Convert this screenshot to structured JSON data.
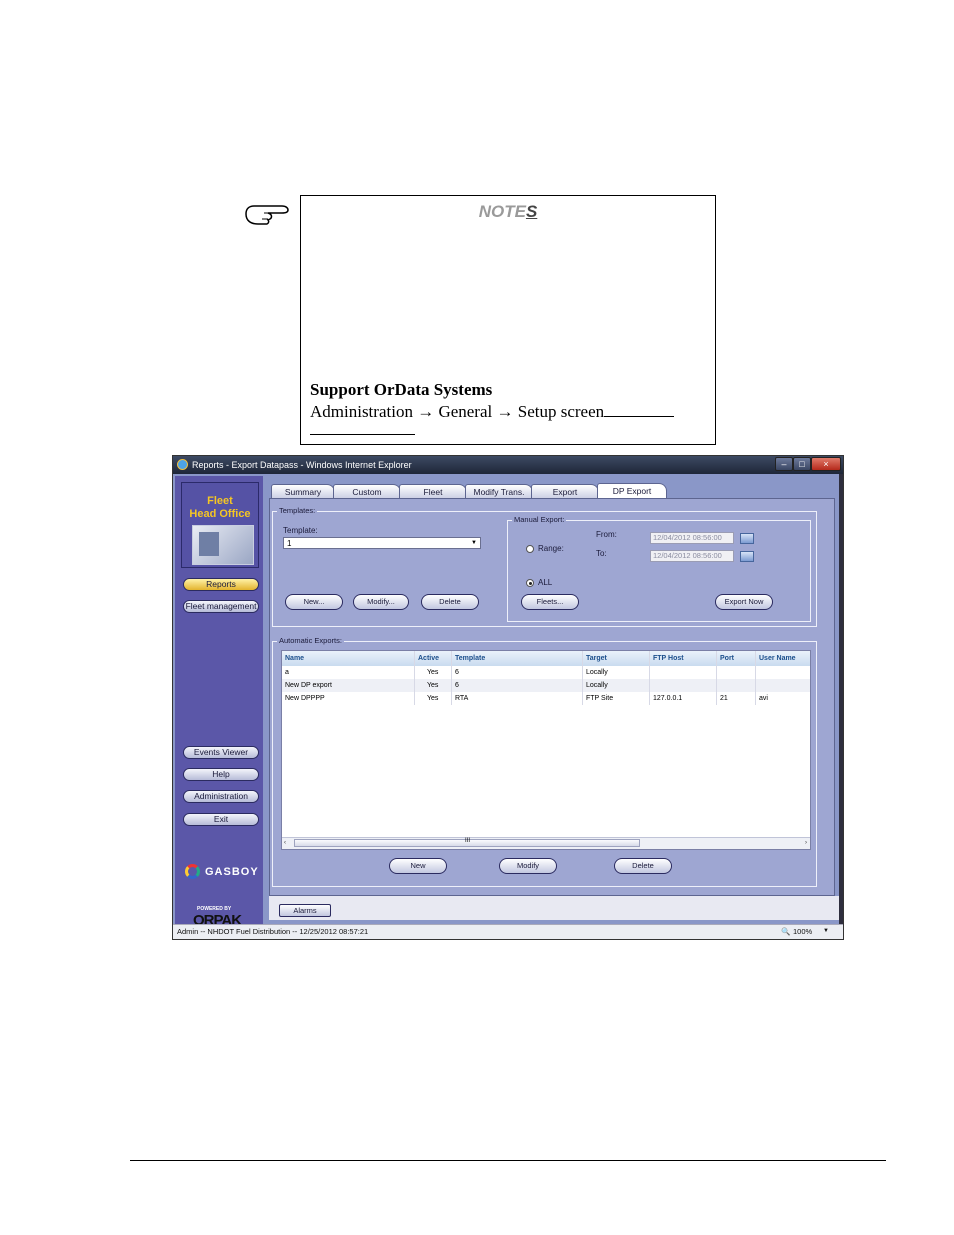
{
  "notes": {
    "title_main": "NOTE",
    "title_last": "S",
    "heading": "Support OrData Systems",
    "path_line": "Administration → General → Setup screen"
  },
  "window": {
    "title": "Reports - Export Datapass - Windows Internet Explorer",
    "min_label": "–",
    "max_label": "□",
    "close_label": "×"
  },
  "sidebar": {
    "logo_line1": "Fleet",
    "logo_line2": "Head Office",
    "nav": [
      "Reports",
      "Fleet management"
    ],
    "bottom": [
      "Events Viewer",
      "Help",
      "Administration",
      "Exit"
    ],
    "brand": "GASBOY",
    "powered_by": "POWERED BY",
    "orpak": "ORPAK"
  },
  "tabs": [
    "Summary",
    "Custom",
    "Fleet",
    "Modify Trans.",
    "Export",
    "DP Export"
  ],
  "templates": {
    "group_label": "Templates:",
    "template_label": "Template:",
    "template_value": "1",
    "buttons": [
      "New...",
      "Modify...",
      "Delete"
    ]
  },
  "manual_export": {
    "group_label": "Manual Export:",
    "range_label": "Range:",
    "all_label": "ALL",
    "from_label": "From:",
    "to_label": "To:",
    "from_value": "12/04/2012 08:56:00",
    "to_value": "12/04/2012 08:56:00",
    "fleets_button": "Fleets...",
    "export_now_button": "Export Now"
  },
  "automatic_exports": {
    "group_label": "Automatic Exports:",
    "columns": [
      "Name",
      "Active",
      "Template",
      "Target",
      "FTP Host",
      "Port",
      "User Name"
    ],
    "rows": [
      [
        "a",
        "Yes",
        "6",
        "Locally",
        "",
        "",
        ""
      ],
      [
        "New DP export",
        "Yes",
        "6",
        "Locally",
        "",
        "",
        ""
      ],
      [
        "New DPPPP",
        "Yes",
        "RTA",
        "FTP Site",
        "127.0.0.1",
        "21",
        "avi"
      ]
    ],
    "scroll_left": "‹",
    "scroll_mid": "III",
    "scroll_right": "›",
    "buttons": [
      "New",
      "Modify",
      "Delete"
    ]
  },
  "alarms_button": "Alarms",
  "status": {
    "text": "Admin -- NHDOT Fuel Distribution -- 12/25/2012  08:57:21",
    "zoom": "100%",
    "zoom_arrow": "▼"
  }
}
